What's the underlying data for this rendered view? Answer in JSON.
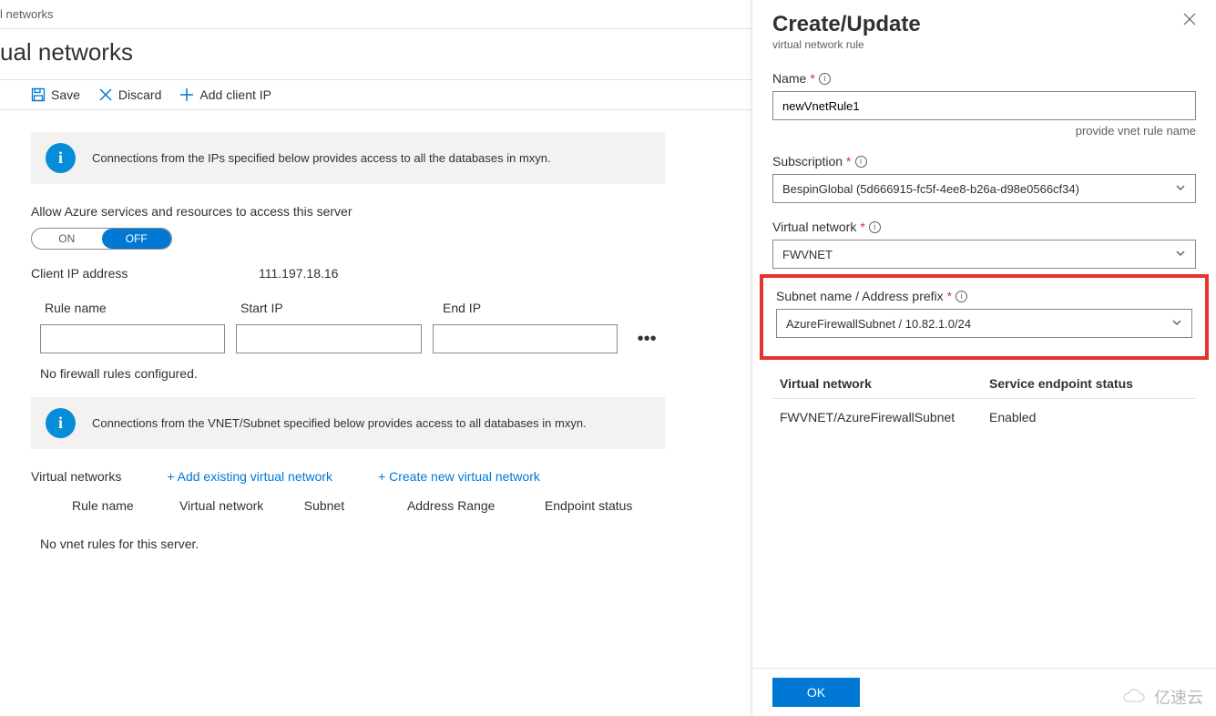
{
  "breadcrumb": "l networks",
  "page_title": "ual networks",
  "toolbar": {
    "save": "Save",
    "discard": "Discard",
    "add_client_ip": "Add client IP"
  },
  "info1": "Connections from the IPs specified below provides access to all the databases in mxyn.",
  "allow_label": "Allow Azure services and resources to access this server",
  "toggle": {
    "on": "ON",
    "off": "OFF"
  },
  "client_ip_label": "Client IP address",
  "client_ip_value": "111.197.18.16",
  "fw_cols": {
    "rule": "Rule name",
    "start": "Start IP",
    "end": "End IP"
  },
  "fw_empty": "No firewall rules configured.",
  "info2": "Connections from the VNET/Subnet specified below provides access to all databases in mxyn.",
  "vnet_section": {
    "label": "Virtual networks",
    "add_existing": "+ Add existing virtual network",
    "create_new": "+ Create new virtual network",
    "cols": {
      "rule": "Rule name",
      "vnet": "Virtual network",
      "subnet": "Subnet",
      "addr": "Address Range",
      "ep": "Endpoint status"
    },
    "empty": "No vnet rules for this server."
  },
  "blade": {
    "title": "Create/Update",
    "subtitle": "virtual network rule",
    "name_label": "Name",
    "name_value": "newVnetRule1",
    "name_helper": "provide vnet rule name",
    "sub_label": "Subscription",
    "sub_value": "BespinGlobal (5d666915-fc5f-4ee8-b26a-d98e0566cf34)",
    "vnet_label": "Virtual network",
    "vnet_value": "FWVNET",
    "subnet_label": "Subnet name / Address prefix",
    "subnet_value": "AzureFirewallSubnet / 10.82.1.0/24",
    "table_head_vnet": "Virtual network",
    "table_head_ep": "Service endpoint status",
    "row_vnet": "FWVNET/AzureFirewallSubnet",
    "row_ep": "Enabled",
    "ok": "OK"
  },
  "watermark": "亿速云"
}
